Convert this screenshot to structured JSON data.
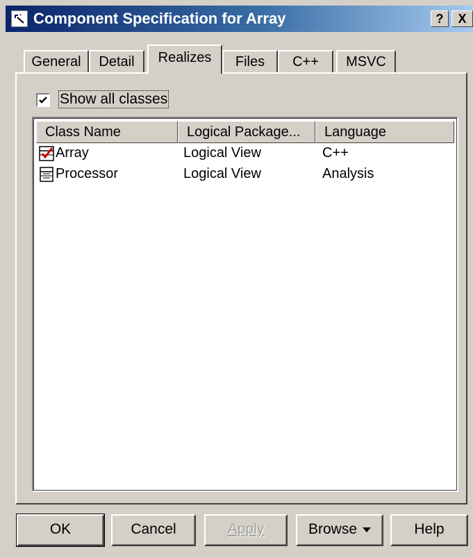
{
  "window": {
    "title": "Component Specification for Array",
    "help_button": "?",
    "close_button": "X"
  },
  "tabs": [
    {
      "label": "General",
      "active": false
    },
    {
      "label": "Detail",
      "active": false
    },
    {
      "label": "Realizes",
      "active": true
    },
    {
      "label": "Files",
      "active": false
    },
    {
      "label": "C++",
      "active": false
    },
    {
      "label": "MSVC",
      "active": false
    }
  ],
  "realizes": {
    "show_all_classes": {
      "label": "Show all classes",
      "checked": true
    },
    "columns": [
      "Class Name",
      "Logical Package...",
      "Language"
    ],
    "rows": [
      {
        "icon": "class-checked-icon",
        "class_name": "Array",
        "package": "Logical View",
        "language": "C++"
      },
      {
        "icon": "class-icon",
        "class_name": "Processor",
        "package": "Logical View",
        "language": "Analysis"
      }
    ]
  },
  "buttons": {
    "ok": "OK",
    "cancel": "Cancel",
    "apply": "Apply",
    "browse": "Browse",
    "help": "Help"
  }
}
